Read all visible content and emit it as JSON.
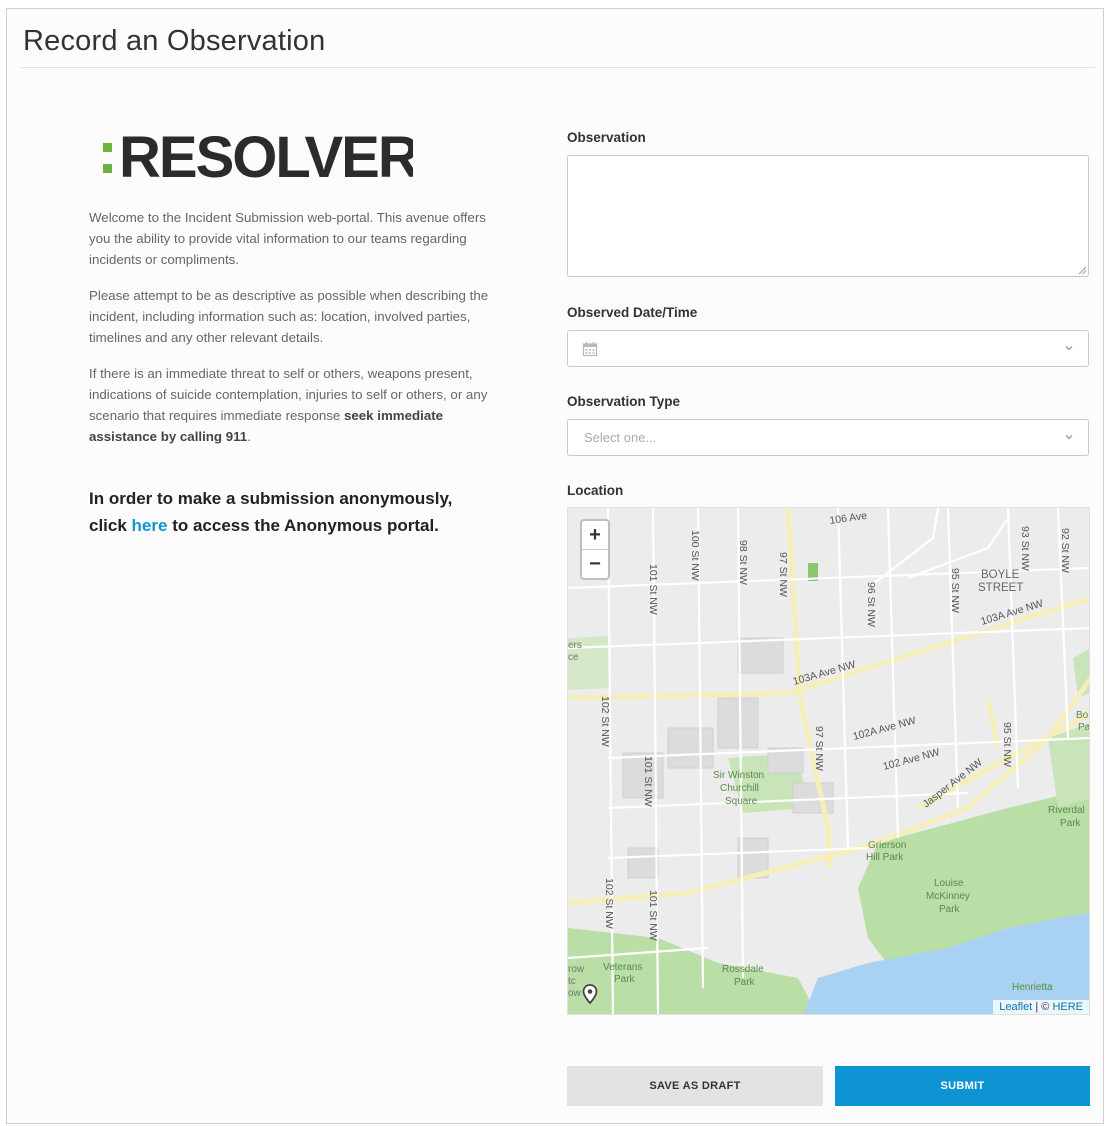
{
  "page": {
    "title": "Record an Observation"
  },
  "logo": {
    "text": "RESOLVER"
  },
  "intro": {
    "p1": "Welcome to the Incident Submission web-portal. This avenue offers you the ability to provide vital information to our teams regarding incidents or compliments.",
    "p2": "Please attempt to be as descriptive as possible when describing the incident, including information such as: location, involved parties, timelines and any other relevant details.",
    "p3_text": "If there is an immediate threat to self or others, weapons present, indications of suicide contemplation, injuries to self or others, or any scenario that requires immediate response ",
    "p3_bold": "seek immediate assistance by calling 911",
    "p3_end": "."
  },
  "anonymous": {
    "line1": "In order to make a submission anonymously,",
    "click": "click ",
    "link": "here",
    "rest": " to access the Anonymous portal."
  },
  "form": {
    "observation_label": "Observation",
    "observation_value": "",
    "date_label": "Observed Date/Time",
    "date_value": "",
    "type_label": "Observation Type",
    "type_placeholder": "Select one...",
    "location_label": "Location"
  },
  "map": {
    "zoom_in": "+",
    "zoom_out": "−",
    "attribution_link": "Leaflet",
    "attribution_sep": " | © ",
    "attribution_here": "HERE",
    "labels": {
      "ave_106": "106 Ave",
      "st_100": "100 St NW",
      "st_98": "98 St NW",
      "st_97_top": "97 St NW",
      "st_101_top": "101 St NW",
      "st_96": "96 St NW",
      "st_95": "95 St NW",
      "st_93": "93 St NW",
      "st_92": "92 St NW",
      "boyle": "BOYLE",
      "street": "STREET",
      "ave_103a_right": "103A Ave NW",
      "ave_103a_mid": "103A Ave NW",
      "ave_102a": "102A Ave NW",
      "ave_102": "102 Ave NW",
      "jasper": "Jasper Ave NW",
      "st_97_mid": "97 St NW",
      "st_95_mid": "95 St NW",
      "st_102_mid": "102 St NW",
      "st_101_mid": "101 St NW",
      "st_102_bot": "102 St NW",
      "st_101_bot": "101 St NW",
      "winston1": "Sir Winston",
      "winston2": "Churchill",
      "winston3": "Square",
      "grierson1": "Grierson",
      "grierson2": "Hill Park",
      "louise1": "Louise",
      "louise2": "McKinney",
      "louise3": "Park",
      "riverdale1": "Riverdal",
      "riverdale2": "Park",
      "veterans1": "Veterans",
      "veterans2": "Park",
      "rossdale1": "Rossdale",
      "rossdale2": "Park",
      "henrietta": "Henrietta",
      "ers": "ers",
      "ce": "ce",
      "bo": "Bo",
      "pa": "Pa",
      "row": "row",
      "tc": "tc",
      "ow": "ow"
    }
  },
  "buttons": {
    "save_draft": "SAVE AS DRAFT",
    "submit": "SUBMIT"
  },
  "colors": {
    "accent": "#0f94d3",
    "logo_green": "#6cb33f",
    "logo_dark": "#2b2b2b"
  }
}
